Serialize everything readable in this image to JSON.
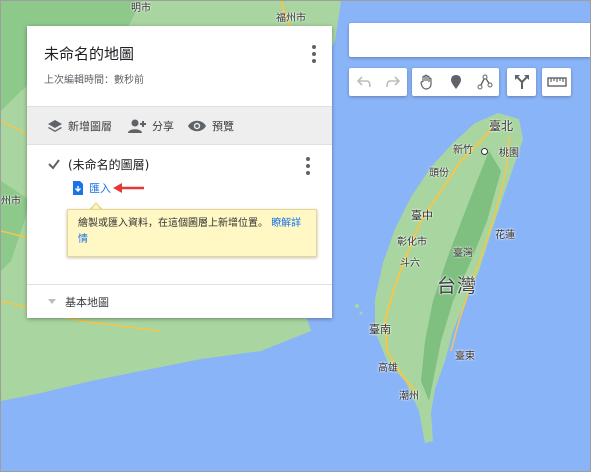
{
  "panel": {
    "title": "未命名的地圖",
    "last_edited": "上次編輯時間：數秒前",
    "actions": {
      "add_layer": "新增圖層",
      "share": "分享",
      "preview": "預覽"
    },
    "layer": {
      "name": "(未命名的圖層)",
      "import_label": "匯入"
    },
    "tooltip": {
      "text": "繪製或匯入資料，在這個圖層上新增位置。",
      "learn_more": "瞭解詳情"
    },
    "basemap_label": "基本地圖"
  },
  "search": {
    "value": ""
  },
  "toolbar": {
    "tools": [
      "undo-icon",
      "redo-icon",
      "hand-icon",
      "marker-icon",
      "draw-line-icon",
      "directions-icon",
      "ruler-icon"
    ]
  },
  "map": {
    "labels": {
      "taipei": "臺北",
      "xinzhu": "新竹",
      "taoyuan": "桃園",
      "toufen": "頭份",
      "taichung": "臺中",
      "changhua": "彰化市",
      "hualien": "花蓮",
      "taiwan_region": "臺灣",
      "douliu": "斗六",
      "taiwan_big": "台灣",
      "tainan": "臺南",
      "taitung": "臺東",
      "kaohsiung": "高雄",
      "chaozhou": "潮州",
      "fuzhou": "福州市",
      "top_partial": "明市",
      "left_partial": "州市"
    },
    "colors": {
      "sea": "#8ab4f8",
      "land": "#a8d5a0",
      "mountain": "#7fbf7f",
      "road": "#f6c64a"
    }
  },
  "annotation": {
    "arrow_color": "#e53935"
  }
}
